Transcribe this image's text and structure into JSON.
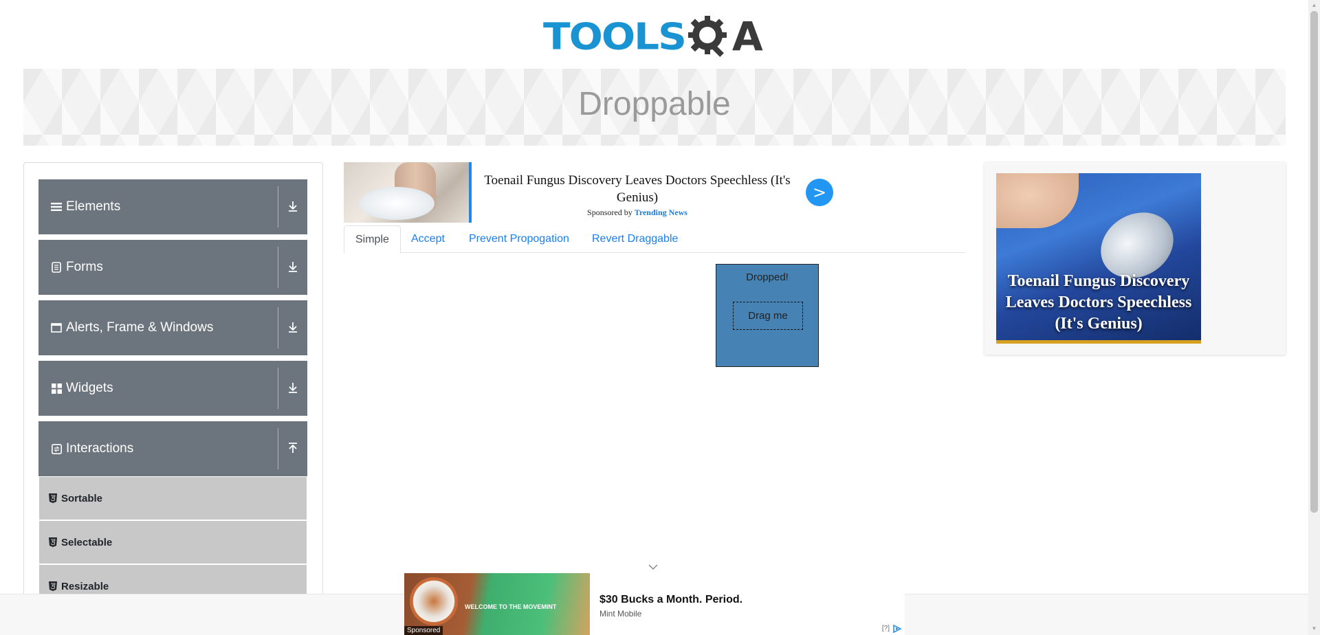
{
  "header": {
    "logo_left": "TOOLS",
    "logo_right": "A"
  },
  "banner": {
    "title": "Droppable"
  },
  "sidebar": {
    "groups": [
      {
        "label": "Elements",
        "icon": "hamburger-icon"
      },
      {
        "label": "Forms",
        "icon": "form-icon"
      },
      {
        "label": "Alerts, Frame & Windows",
        "icon": "window-icon"
      },
      {
        "label": "Widgets",
        "icon": "widgets-icon"
      },
      {
        "label": "Interactions",
        "icon": "interactions-icon"
      }
    ],
    "items": [
      {
        "label": "Sortable"
      },
      {
        "label": "Selectable"
      },
      {
        "label": "Resizable"
      }
    ]
  },
  "ad_top": {
    "title": "Toenail Fungus Discovery Leaves Doctors Speechless (It's Genius)",
    "sponsored_by": "Sponsored by",
    "sponsor": "Trending News",
    "button": ">"
  },
  "tabs": [
    {
      "label": "Simple",
      "active": true
    },
    {
      "label": "Accept",
      "active": false
    },
    {
      "label": "Prevent Propogation",
      "active": false
    },
    {
      "label": "Revert Draggable",
      "active": false
    }
  ],
  "droppable": {
    "drop_text": "Dropped!",
    "drag_text": "Drag me"
  },
  "ad_right": {
    "text": "Toenail Fungus Discovery Leaves Doctors Speechless (It's Genius)"
  },
  "ad_bottom": {
    "headline": "$30 Bucks a Month. Period.",
    "advertiser": "Mint Mobile",
    "sponsored": "Sponsored",
    "image_text": "WELCOME TO THE MOVEMINT",
    "info": "[?]"
  },
  "colors": {
    "accent": "#1993d1",
    "sidebar_group": "#6c757d",
    "sidebar_item": "#c8c8c8",
    "drop_box": "#4682b4",
    "tab_link": "#1b7ef0"
  }
}
